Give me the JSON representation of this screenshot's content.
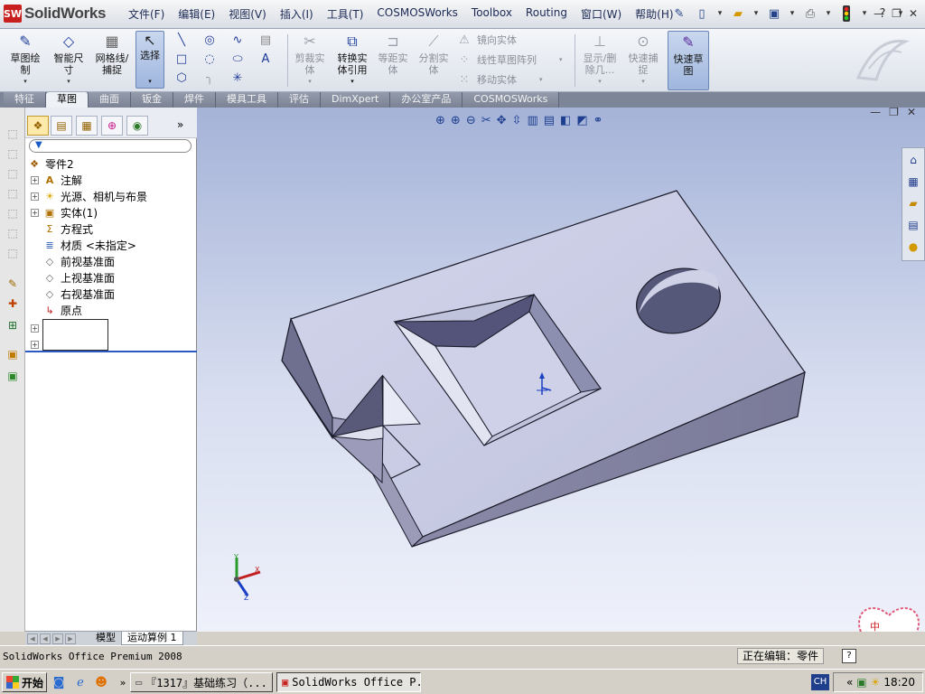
{
  "app": {
    "logo_text": "SolidWorks",
    "logo_badge": "SW"
  },
  "menu": [
    "文件(F)",
    "编辑(E)",
    "视图(V)",
    "插入(I)",
    "工具(T)",
    "COSMOSWorks",
    "Toolbox",
    "Routing",
    "窗口(W)",
    "帮助(H)"
  ],
  "ribbon": {
    "sketch": "草图绘\n制",
    "smart_dimension": "智能尺\n寸",
    "grid_snap": "网格线/\n捕捉",
    "select": "选择",
    "trim": "剪裁实\n体",
    "convert": "转换实\n体引用",
    "offset": "等距实\n体",
    "split": "分割实\n体",
    "mirror": "镜向实体",
    "linear_pattern": "线性草图阵列",
    "move": "移动实体",
    "show_delete": "显示/删\n除几...",
    "quick_snaps": "快速捕\n捉",
    "rapid_sketch": "快速草\n图"
  },
  "tabs": [
    "特征",
    "草图",
    "曲面",
    "钣金",
    "焊件",
    "模具工具",
    "评估",
    "DimXpert",
    "办公室产品",
    "COSMOSWorks"
  ],
  "active_tab": "草图",
  "feature_tree": {
    "root": "零件2",
    "items": [
      {
        "label": "注解",
        "icon": "A",
        "expandable": true
      },
      {
        "label": "光源、相机与布景",
        "icon": "☀",
        "expandable": true
      },
      {
        "label": "实体(1)",
        "icon": "▣",
        "expandable": true
      },
      {
        "label": "方程式",
        "icon": "Σ",
        "expandable": false
      },
      {
        "label": "材质 <未指定>",
        "icon": "≣",
        "expandable": false
      },
      {
        "label": "前视基准面",
        "icon": "◇",
        "expandable": false
      },
      {
        "label": "上视基准面",
        "icon": "◇",
        "expandable": false
      },
      {
        "label": "右视基准面",
        "icon": "◇",
        "expandable": false
      },
      {
        "label": "原点",
        "icon": "↳",
        "expandable": false
      }
    ]
  },
  "bottom_tabs": [
    "模型",
    "运动算例 1"
  ],
  "status": {
    "left": "SolidWorks Office Premium 2008",
    "editing": "正在编辑：零件",
    "help": "?"
  },
  "triad": {
    "x": "X",
    "y": "Y",
    "z": "Z"
  },
  "badge_text": "中",
  "taskbar": {
    "start": "开始",
    "tasks": [
      "『1317』基础练习（...",
      "SolidWorks Office P..."
    ],
    "ime": "CH",
    "clock": "18:20",
    "tray_chevron": "«",
    "ql_chevron": "»"
  },
  "colors": {
    "viewport_top": "#a5b3d8",
    "viewport_bottom": "#eef1fa",
    "part_top": "#c9cce6",
    "part_side": "#6d6d8d",
    "part_front": "#8c8caa"
  }
}
